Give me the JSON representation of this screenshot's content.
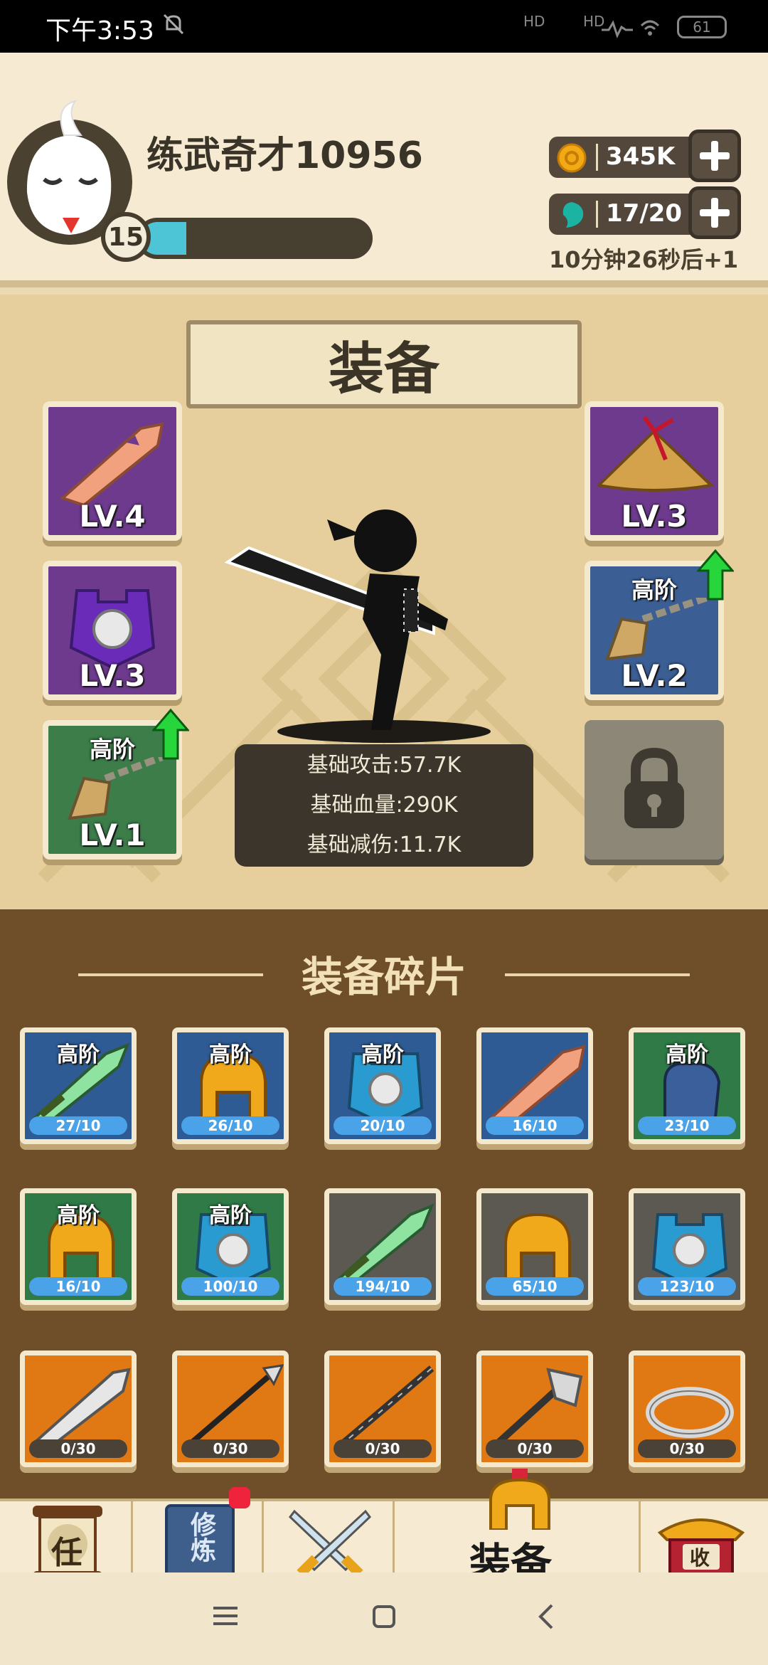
{
  "status_bar": {
    "time": "下午3:53",
    "hd1": "HD",
    "hd2": "HD",
    "battery": "61"
  },
  "profile": {
    "name": "练武奇才10956",
    "level": "15",
    "xp_fraction": 0.2
  },
  "resources": {
    "coins": "345K",
    "energy": "17/20",
    "timer": "10分钟26秒后+1"
  },
  "equipment": {
    "title": "装备",
    "left_slots": [
      {
        "level": "LV.4",
        "tier": "",
        "color": "#6e3a8e",
        "item": "blade"
      },
      {
        "level": "LV.3",
        "tier": "",
        "color": "#6e3a8e",
        "item": "armor"
      },
      {
        "level": "LV.1",
        "tier": "高阶",
        "color": "#3c7d4a",
        "item": "amulet",
        "upgrade": true
      }
    ],
    "right_slots": [
      {
        "level": "LV.3",
        "tier": "",
        "color": "#6e3a8e",
        "item": "hat"
      },
      {
        "level": "LV.2",
        "tier": "高阶",
        "color": "#3b5f95",
        "item": "amulet",
        "upgrade": true
      },
      {
        "level": "",
        "tier": "",
        "color": "#8d8777",
        "item": "locked"
      }
    ],
    "stats": {
      "attack": "基础攻击:57.7K",
      "health": "基础血量:290K",
      "defense": "基础减伤:11.7K"
    }
  },
  "fragments": {
    "title": "装备碎片",
    "items": [
      {
        "tier": "高阶",
        "count": "27/10",
        "bg": "blue",
        "icon": "sword"
      },
      {
        "tier": "高阶",
        "count": "26/10",
        "bg": "blue",
        "icon": "helmet"
      },
      {
        "tier": "高阶",
        "count": "20/10",
        "bg": "blue",
        "icon": "armor"
      },
      {
        "tier": "",
        "count": "16/10",
        "bg": "blue",
        "icon": "blade"
      },
      {
        "tier": "高阶",
        "count": "23/10",
        "bg": "green",
        "icon": "gauntlet"
      },
      {
        "tier": "高阶",
        "count": "16/10",
        "bg": "green",
        "icon": "helmet"
      },
      {
        "tier": "高阶",
        "count": "100/10",
        "bg": "green",
        "icon": "armor"
      },
      {
        "tier": "",
        "count": "194/10",
        "bg": "darkgray",
        "icon": "sword"
      },
      {
        "tier": "",
        "count": "65/10",
        "bg": "darkgray",
        "icon": "helmet"
      },
      {
        "tier": "",
        "count": "123/10",
        "bg": "darkgray",
        "icon": "armor"
      },
      {
        "tier": "",
        "count": "0/30",
        "bg": "orange",
        "icon": "broadsword"
      },
      {
        "tier": "",
        "count": "0/30",
        "bg": "orange",
        "icon": "spear"
      },
      {
        "tier": "",
        "count": "0/30",
        "bg": "orange",
        "icon": "staff"
      },
      {
        "tier": "",
        "count": "0/30",
        "bg": "orange",
        "icon": "axe"
      },
      {
        "tier": "",
        "count": "0/30",
        "bg": "orange",
        "icon": "ring"
      }
    ]
  },
  "nav": {
    "tab_task": "任",
    "tab_train": "修炼",
    "tab_equip": "装备",
    "tab_collect": "收"
  }
}
